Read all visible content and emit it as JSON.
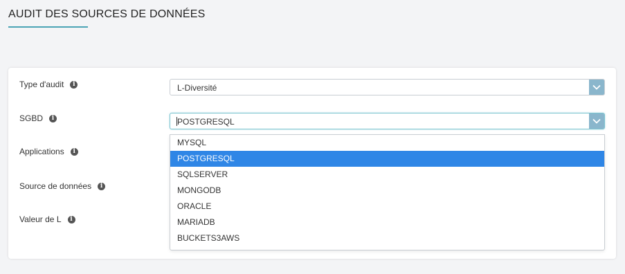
{
  "page": {
    "title": "AUDIT DES SOURCES DE DONNÉES"
  },
  "form": {
    "fields": [
      {
        "label": "Type d'audit"
      },
      {
        "label": "SGBD"
      },
      {
        "label": "Applications"
      },
      {
        "label": "Source de données"
      },
      {
        "label": "Valeur de L"
      }
    ],
    "info_icon": "info-icon",
    "audit_type": {
      "value": "L-Diversité"
    },
    "sgbd": {
      "value": "POSTGRESQL",
      "options": [
        "MYSQL",
        "POSTGRESQL",
        "SQLSERVER",
        "MONGODB",
        "ORACLE",
        "MARIADB",
        "BUCKETS3AWS"
      ],
      "selected_index": 1
    }
  },
  "colors": {
    "accent": "#4aa3b5",
    "select_button": "#8ab6cc",
    "option_highlight": "#2f86e6"
  }
}
